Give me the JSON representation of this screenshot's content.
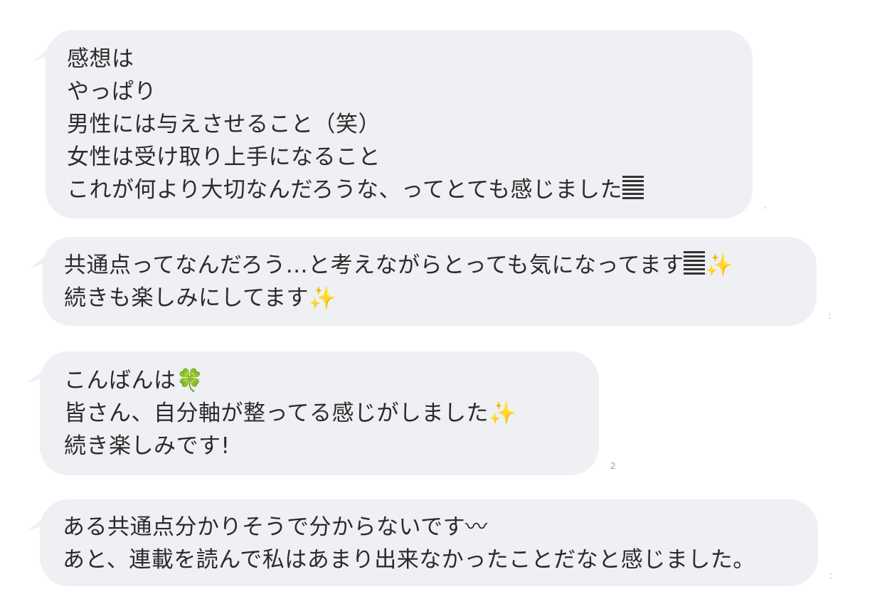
{
  "messages": [
    {
      "lines": [
        "感想は",
        "やっぱり",
        "男性には与えさせること（笑）",
        "女性は受け取り上手になること",
        "これが何より大切なんだろうな、ってとても感じました"
      ],
      "meta": "."
    },
    {
      "lines": [
        "共通点ってなんだろう…と考えながらとっても気になってます",
        "続きも楽しみにしてます"
      ],
      "meta": ":"
    },
    {
      "lines": [
        "こんばんは",
        "皆さん、自分軸が整ってる感じがしました",
        "続き楽しみです!"
      ],
      "meta": "2"
    },
    {
      "lines": [
        "ある共通点分かりそうで分からないです〰",
        "あと、連載を読んで私はあまり出来なかったことだなと感じました。"
      ],
      "meta": ":"
    }
  ],
  "icons": {
    "sparkle": "✨",
    "clover": "🍀"
  },
  "colors": {
    "bubble": "#eff0f3",
    "text": "#2b2b2b",
    "background": "#ffffff"
  }
}
